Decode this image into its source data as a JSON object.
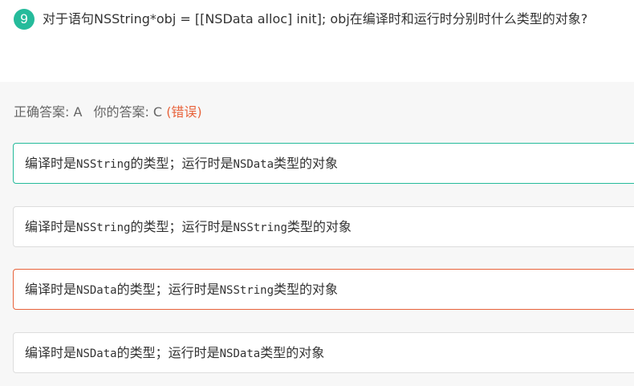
{
  "colors": {
    "accent": "#25bb9b",
    "error": "#e8633b",
    "border": "#dddddd",
    "panel_bg": "#f7f7f7"
  },
  "question": {
    "number": "9",
    "text": "对于语句NSString*obj = [[NSData alloc] init]; obj在编译时和运行时分别时什么类型的对象?"
  },
  "result": {
    "correct_label": "正确答案: A",
    "your_label": "你的答案: C",
    "status": "(错误)"
  },
  "options": [
    {
      "pre": "编译时是",
      "code": "NSString",
      "post": "的类型；运行时是",
      "code2": "NSData",
      "post2": "类型的对象",
      "state": "correct"
    },
    {
      "pre": "编译时是",
      "code": "NSString",
      "post": "的类型；运行时是",
      "code2": "NSString",
      "post2": "类型的对象",
      "state": "normal"
    },
    {
      "pre": "编译时是",
      "code": "NSData",
      "post": "的类型；运行时是",
      "code2": "NSString",
      "post2": "类型的对象",
      "state": "wrong"
    },
    {
      "pre": "编译时是",
      "code": "NSData",
      "post": "的类型；运行时是",
      "code2": "NSData",
      "post2": "类型的对象",
      "state": "normal"
    }
  ]
}
